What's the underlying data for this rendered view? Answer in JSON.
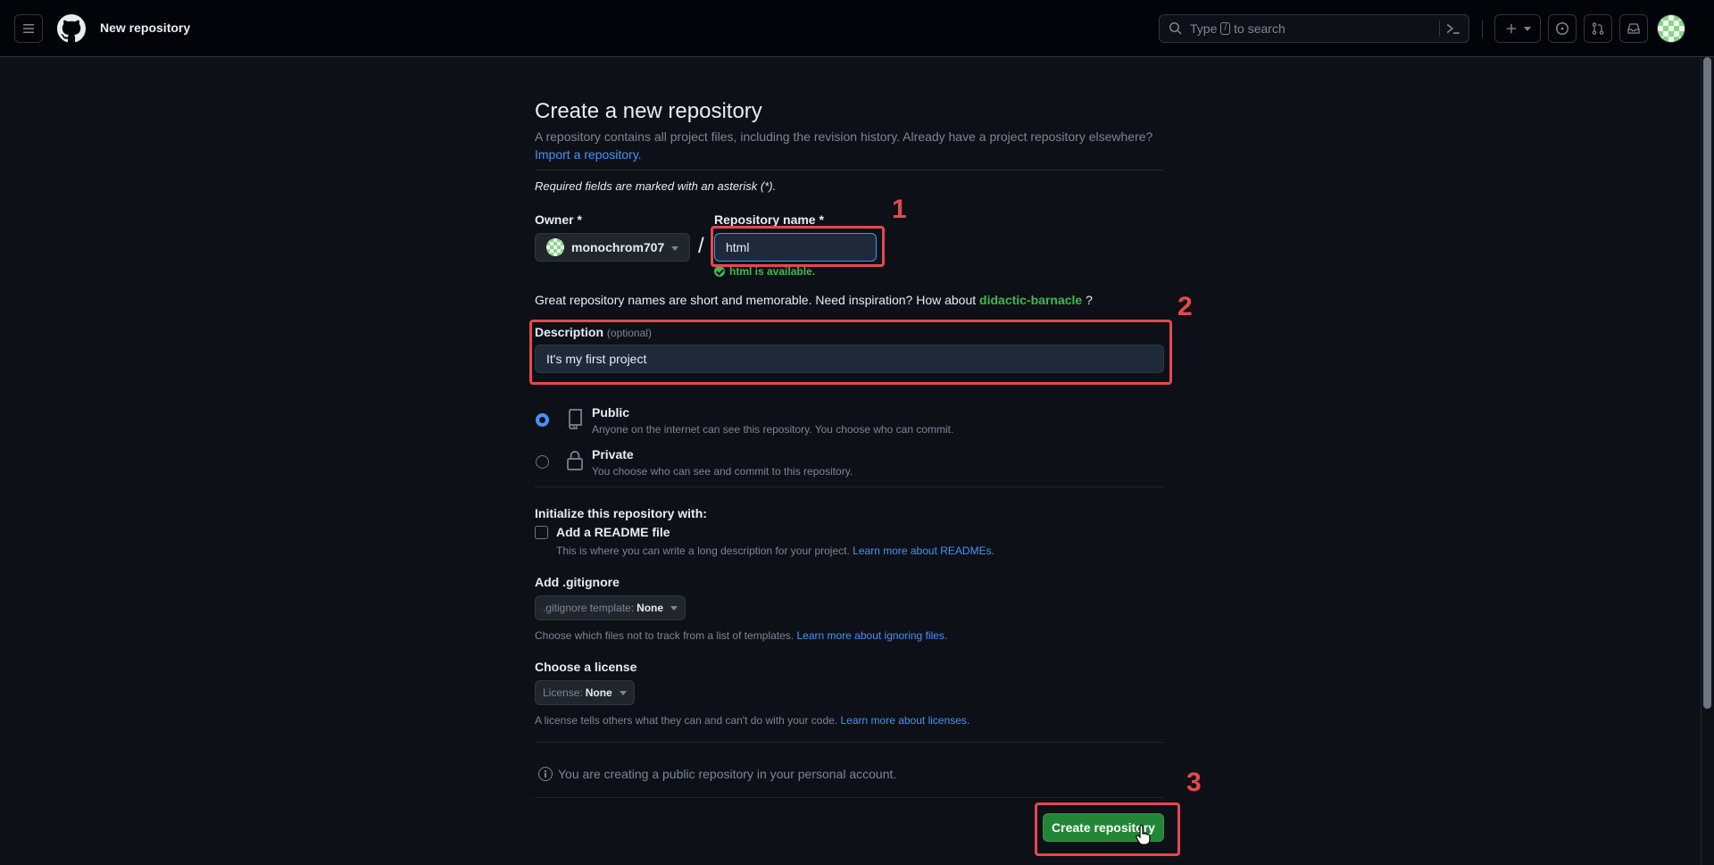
{
  "header": {
    "context_title": "New repository",
    "search_prefix": "Type",
    "search_key": "/",
    "search_suffix": "to search"
  },
  "form": {
    "title": "Create a new repository",
    "subtitle": "A repository contains all project files, including the revision history. Already have a project repository elsewhere?",
    "import_link": "Import a repository.",
    "required_note": "Required fields are marked with an asterisk (*).",
    "owner_label": "Owner *",
    "owner_value": "monochrom707",
    "slash": "/",
    "repo_label": "Repository name *",
    "repo_value": "html",
    "availability": "html is available.",
    "inspiration_text": "Great repository names are short and memorable. Need inspiration? How about",
    "suggestion": "didactic-barnacle",
    "inspiration_end": "?",
    "description_label": "Description",
    "description_optional": "(optional)",
    "description_value": "It's my first project",
    "visibility": {
      "public_title": "Public",
      "public_desc": "Anyone on the internet can see this repository. You choose who can commit.",
      "private_title": "Private",
      "private_desc": "You choose who can see and commit to this repository.",
      "selected": "public"
    },
    "init_title": "Initialize this repository with:",
    "readme_label": "Add a README file",
    "readme_desc": "This is where you can write a long description for your project.",
    "readme_link": "Learn more about READMEs.",
    "gitignore_label": "Add .gitignore",
    "gitignore_select_prefix": ".gitignore template:",
    "gitignore_select_value": "None",
    "gitignore_desc": "Choose which files not to track from a list of templates.",
    "gitignore_link": "Learn more about ignoring files.",
    "license_label": "Choose a license",
    "license_select_prefix": "License:",
    "license_select_value": "None",
    "license_desc": "A license tells others what they can and can't do with your code.",
    "license_link": "Learn more about licenses.",
    "info_text": "You are creating a public repository in your personal account.",
    "create_button": "Create repository"
  },
  "annotations": {
    "step1": "1",
    "step2": "2",
    "step3": "3",
    "color": "#e5484d"
  },
  "colors": {
    "background": "#0d1117",
    "header_bg": "#010409",
    "accent_blue": "#4493f8",
    "success_green": "#3fb950",
    "button_green": "#238636"
  }
}
